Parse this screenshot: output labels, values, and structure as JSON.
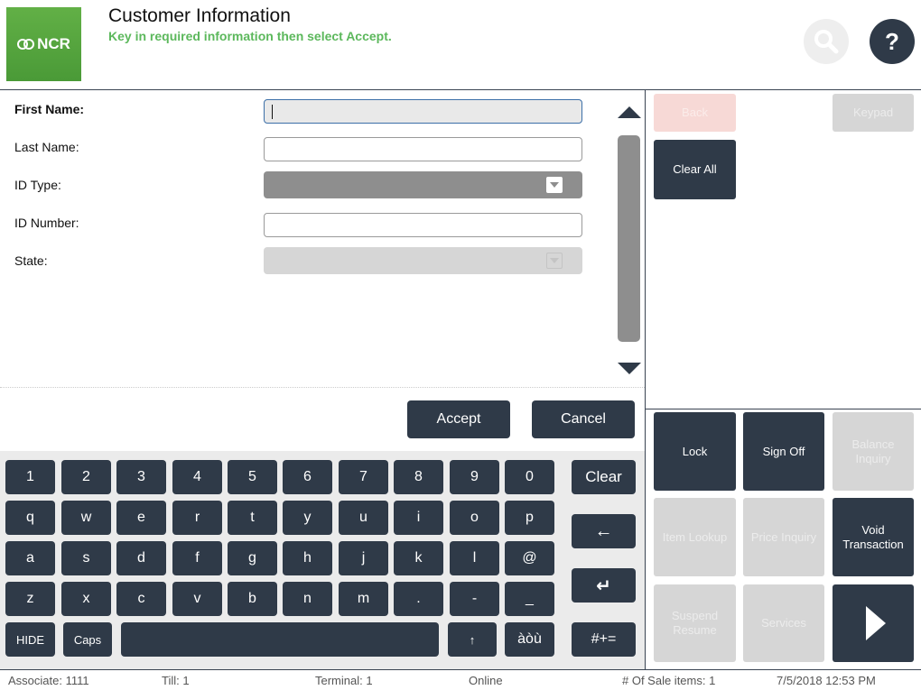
{
  "header": {
    "logo_text": "NCR",
    "title": "Customer Information",
    "subtitle": "Key in required information then select Accept.",
    "help_label": "?"
  },
  "form": {
    "fields": [
      {
        "label": "First Name:",
        "value": ""
      },
      {
        "label": "Last Name:",
        "value": ""
      },
      {
        "label": "ID Type:",
        "value": ""
      },
      {
        "label": "ID Number:",
        "value": ""
      },
      {
        "label": "State:",
        "value": ""
      }
    ],
    "accept_label": "Accept",
    "cancel_label": "Cancel"
  },
  "keyboard": {
    "row1": [
      "1",
      "2",
      "3",
      "4",
      "5",
      "6",
      "7",
      "8",
      "9",
      "0"
    ],
    "row2": [
      "q",
      "w",
      "e",
      "r",
      "t",
      "y",
      "u",
      "i",
      "o",
      "p"
    ],
    "row3": [
      "a",
      "s",
      "d",
      "f",
      "g",
      "h",
      "j",
      "k",
      "l",
      "@"
    ],
    "row4": [
      "z",
      "x",
      "c",
      "v",
      "b",
      "n",
      "m",
      ".",
      "-",
      "_"
    ],
    "hide": "HIDE",
    "caps": "Caps",
    "shift": "↑",
    "accents": "àòù",
    "clear": "Clear",
    "backspace": "←",
    "enter": "↵",
    "symbols": "#+="
  },
  "right_panel": {
    "back": "Back",
    "keypad": "Keypad",
    "clear_all": "Clear All",
    "lock": "Lock",
    "sign_off": "Sign Off",
    "balance_inquiry": "Balance Inquiry",
    "item_lookup": "Item Lookup",
    "price_inquiry": "Price Inquiry",
    "void_transaction": "Void Transaction",
    "suspend_resume": "Suspend Resume",
    "services": "Services"
  },
  "footer": {
    "associate": "Associate: 1111",
    "till": "Till: 1",
    "terminal": "Terminal: 1",
    "status": "Online",
    "sale_items": "# Of Sale items: 1",
    "datetime": "7/5/2018 12:53 PM"
  }
}
